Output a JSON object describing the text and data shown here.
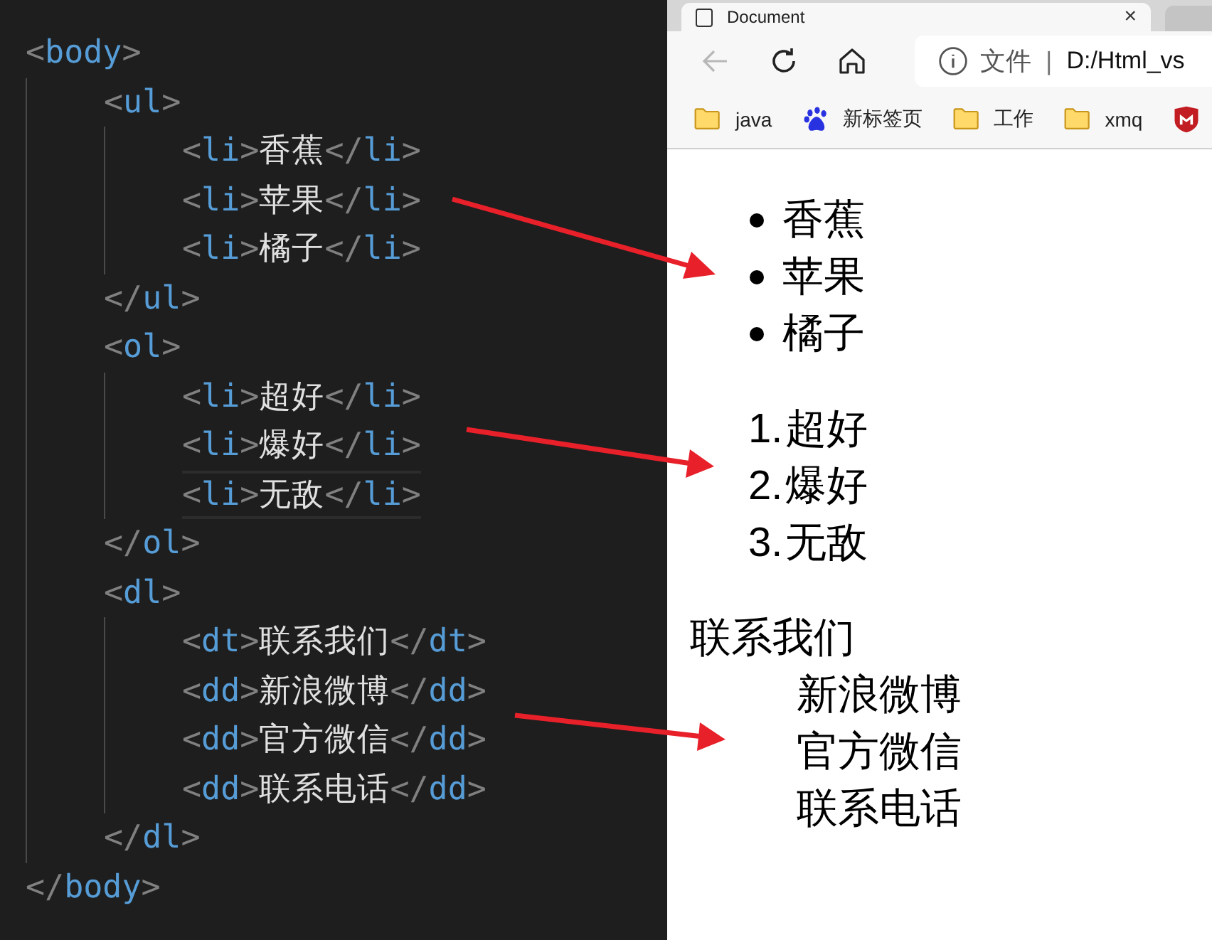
{
  "editor": {
    "lines": [
      {
        "open": "<body>",
        "close": "</body>",
        "children": [
          {
            "open": "<ul>",
            "close": "</ul>",
            "children": [
              {
                "text": "<li>香蕉</li>",
                "current": false
              },
              {
                "text": "<li>苹果</li>",
                "current": false
              },
              {
                "text": "<li>橘子</li>",
                "current": false
              }
            ]
          },
          {
            "open": "<ol>",
            "close": "</ol>",
            "children": [
              {
                "text": "<li>超好</li>",
                "current": false
              },
              {
                "text": "<li>爆好</li>",
                "current": false
              },
              {
                "text": "<li>无敌</li>",
                "current": true
              }
            ]
          },
          {
            "open": "<dl>",
            "close": "</dl>",
            "children": [
              {
                "text": "<dt>联系我们</dt>",
                "current": false
              },
              {
                "text": "<dd>新浪微博</dd>",
                "current": false
              },
              {
                "text": "<dd>官方微信</dd>",
                "current": false
              },
              {
                "text": "<dd>联系电话</dd>",
                "current": false
              }
            ]
          }
        ]
      }
    ]
  },
  "browser": {
    "tab": {
      "title": "Document",
      "close": "×"
    },
    "address": {
      "security": "文件",
      "separator": "|",
      "url": "D:/Html_vs"
    },
    "bookmarks": [
      {
        "kind": "folder",
        "label": "java"
      },
      {
        "kind": "paw",
        "label": "新标签页"
      },
      {
        "kind": "folder",
        "label": "工作"
      },
      {
        "kind": "folder",
        "label": "xmq"
      },
      {
        "kind": "shield"
      }
    ],
    "page": {
      "unordered": [
        "香蕉",
        "苹果",
        "橘子"
      ],
      "ordered": [
        {
          "number": "1.",
          "text": "超好"
        },
        {
          "number": "2.",
          "text": "爆好"
        },
        {
          "number": "3.",
          "text": "无敌"
        }
      ],
      "definition": {
        "term": "联系我们",
        "descriptions": [
          "新浪微博",
          "官方微信",
          "联系电话"
        ]
      }
    }
  }
}
